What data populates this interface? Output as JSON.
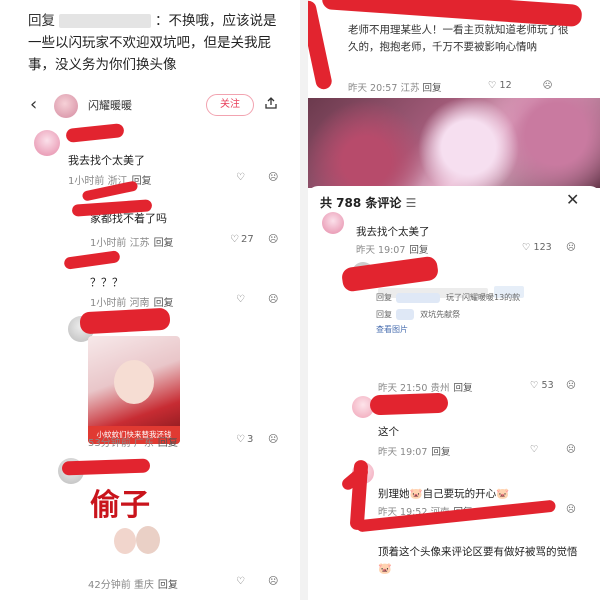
{
  "left": {
    "reply_label": "回复",
    "reply_body": "：不换哦，应该说是一些以闪玩家不欢迎双坑吧，但是关我屁事，没义务为你们换头像",
    "nav": {
      "username": "闪耀暖暖",
      "follow_label": "关注"
    },
    "comments": [
      {
        "text": "我去找个太美了",
        "time": "1小时前",
        "loc": "浙江",
        "reply": "回复"
      },
      {
        "text": "家都找不着了吗",
        "time": "1小时前",
        "loc": "江苏",
        "reply": "回复",
        "likes": "27"
      },
      {
        "text": "？？？",
        "time": "1小时前",
        "loc": "河南",
        "reply": "回复"
      },
      {
        "sticker_text": "小蚊蚊们快来替我还钱",
        "time": "53分钟前",
        "loc": "广东",
        "reply": "回复",
        "likes": "3"
      },
      {
        "sticker_text": "偷子",
        "time": "42分钟前",
        "loc": "重庆",
        "reply": "回复"
      }
    ]
  },
  "right": {
    "top_comment": "老师不用理某些人！一看主页就知道老师玩了很久的，抱抱老师，千万不要被影响心情呐",
    "top_time": "昨天 20:57",
    "top_loc": "江苏",
    "top_reply": "回复",
    "top_likes": "12",
    "sheet_title": "共 788 条评论",
    "comments": [
      {
        "text": "我去找个太美了",
        "time": "昨天 19:07",
        "reply": "回复",
        "likes": "123"
      },
      {
        "time": "昨天 21:50",
        "loc": "贵州",
        "reply": "回复",
        "likes": "53"
      },
      {
        "text": "这个",
        "time": "昨天 19:07",
        "reply": "回复"
      },
      {
        "text": "别理她",
        "text2": "自己要玩的开心",
        "time": "昨天 19:52",
        "loc": "河南",
        "reply": "回复"
      },
      {
        "text": "顶着这个头像来评论区要有做好被骂的觉悟"
      }
    ],
    "nested": {
      "reply": "回复",
      "line1": "玩了闪耀暖暖13的款",
      "line2": "双坑先献祭",
      "more": "查看图片"
    }
  }
}
